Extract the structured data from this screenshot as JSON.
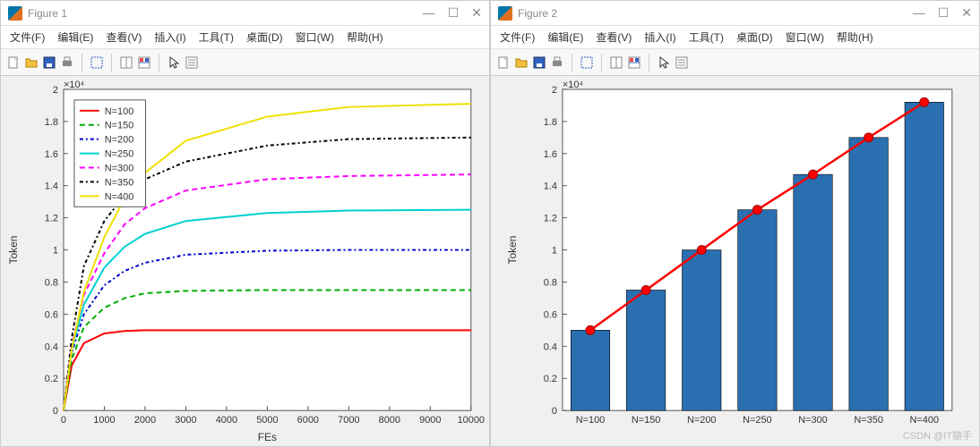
{
  "watermark": "CSDN @IT猿手",
  "fig1": {
    "title": "Figure 1",
    "menus": [
      "文件(F)",
      "编辑(E)",
      "查看(V)",
      "插入(I)",
      "工具(T)",
      "桌面(D)",
      "窗口(W)",
      "帮助(H)"
    ]
  },
  "fig2": {
    "title": "Figure 2",
    "menus": [
      "文件(F)",
      "编辑(E)",
      "查看(V)",
      "插入(I)",
      "工具(T)",
      "桌面(D)",
      "窗口(W)",
      "帮助(H)"
    ]
  },
  "chart_data": [
    {
      "type": "line",
      "title": "",
      "xlabel": "FEs",
      "ylabel": "Token",
      "xlim": [
        0,
        10000
      ],
      "ylim": [
        0,
        20000
      ],
      "y_multiplier_label": "×10⁴",
      "x_ticks": [
        0,
        1000,
        2000,
        3000,
        4000,
        5000,
        6000,
        7000,
        8000,
        9000,
        10000
      ],
      "y_ticks": [
        0,
        2000,
        4000,
        6000,
        8000,
        10000,
        12000,
        14000,
        16000,
        18000,
        20000
      ],
      "y_tick_labels": [
        "0",
        "0.2",
        "0.4",
        "0.6",
        "0.8",
        "1",
        "1.2",
        "1.4",
        "1.6",
        "1.8",
        "2"
      ],
      "series": [
        {
          "name": "N=100",
          "color": "#ff0000",
          "dash": "",
          "width": 2,
          "x": [
            0,
            200,
            500,
            1000,
            1500,
            2000,
            3000,
            5000,
            7000,
            10000
          ],
          "y": [
            0,
            2800,
            4200,
            4800,
            4950,
            5000,
            5000,
            5000,
            5000,
            5000
          ]
        },
        {
          "name": "N=150",
          "color": "#00b000",
          "dash": "6,4",
          "width": 2,
          "x": [
            0,
            200,
            500,
            1000,
            1500,
            2000,
            3000,
            5000,
            7000,
            10000
          ],
          "y": [
            0,
            3200,
            5200,
            6400,
            7000,
            7300,
            7450,
            7500,
            7500,
            7500
          ]
        },
        {
          "name": "N=200",
          "color": "#0000d0",
          "dash": "4,3,2,3",
          "width": 2,
          "x": [
            0,
            200,
            500,
            1000,
            1500,
            2000,
            3000,
            5000,
            7000,
            10000
          ],
          "y": [
            0,
            3600,
            6000,
            7800,
            8700,
            9200,
            9700,
            9950,
            10000,
            10000
          ]
        },
        {
          "name": "N=250",
          "color": "#00d0d0",
          "dash": "",
          "width": 2,
          "x": [
            0,
            200,
            500,
            1000,
            1500,
            2000,
            3000,
            5000,
            7000,
            10000
          ],
          "y": [
            0,
            3800,
            6600,
            8900,
            10200,
            11000,
            11800,
            12300,
            12450,
            12500
          ]
        },
        {
          "name": "N=300",
          "color": "#ff00ff",
          "dash": "6,4",
          "width": 2,
          "x": [
            0,
            200,
            500,
            1000,
            1500,
            2000,
            3000,
            5000,
            7000,
            10000
          ],
          "y": [
            0,
            4000,
            7200,
            9800,
            11600,
            12600,
            13700,
            14400,
            14600,
            14700
          ]
        },
        {
          "name": "N=350",
          "color": "#000000",
          "dash": "4,3,2,3",
          "width": 2,
          "x": [
            0,
            200,
            500,
            1000,
            1500,
            2000,
            3000,
            5000,
            7000,
            10000
          ],
          "y": [
            0,
            4500,
            9000,
            11800,
            13400,
            14400,
            15500,
            16500,
            16900,
            17000
          ]
        },
        {
          "name": "N=400",
          "color": "#f0e000",
          "dash": "",
          "width": 2,
          "x": [
            0,
            200,
            500,
            1000,
            1500,
            2000,
            3000,
            5000,
            7000,
            10000
          ],
          "y": [
            0,
            3800,
            7400,
            10800,
            13200,
            14800,
            16800,
            18300,
            18900,
            19100
          ]
        }
      ]
    },
    {
      "type": "bar",
      "title": "",
      "xlabel": "",
      "ylabel": "Token",
      "ylim": [
        0,
        20000
      ],
      "y_multiplier_label": "×10⁴",
      "y_ticks": [
        0,
        2000,
        4000,
        6000,
        8000,
        10000,
        12000,
        14000,
        16000,
        18000,
        20000
      ],
      "y_tick_labels": [
        "0",
        "0.2",
        "0.4",
        "0.6",
        "0.8",
        "1",
        "1.2",
        "1.4",
        "1.6",
        "1.8",
        "2"
      ],
      "categories": [
        "N=100",
        "N=150",
        "N=200",
        "N=250",
        "N=300",
        "N=350",
        "N=400"
      ],
      "values": [
        5000,
        7500,
        10000,
        12500,
        14700,
        17000,
        19200
      ],
      "bar_color": "#2a6fb0",
      "overlay_line": {
        "color": "#ff0000",
        "marker_color": "#ff0000"
      }
    }
  ]
}
